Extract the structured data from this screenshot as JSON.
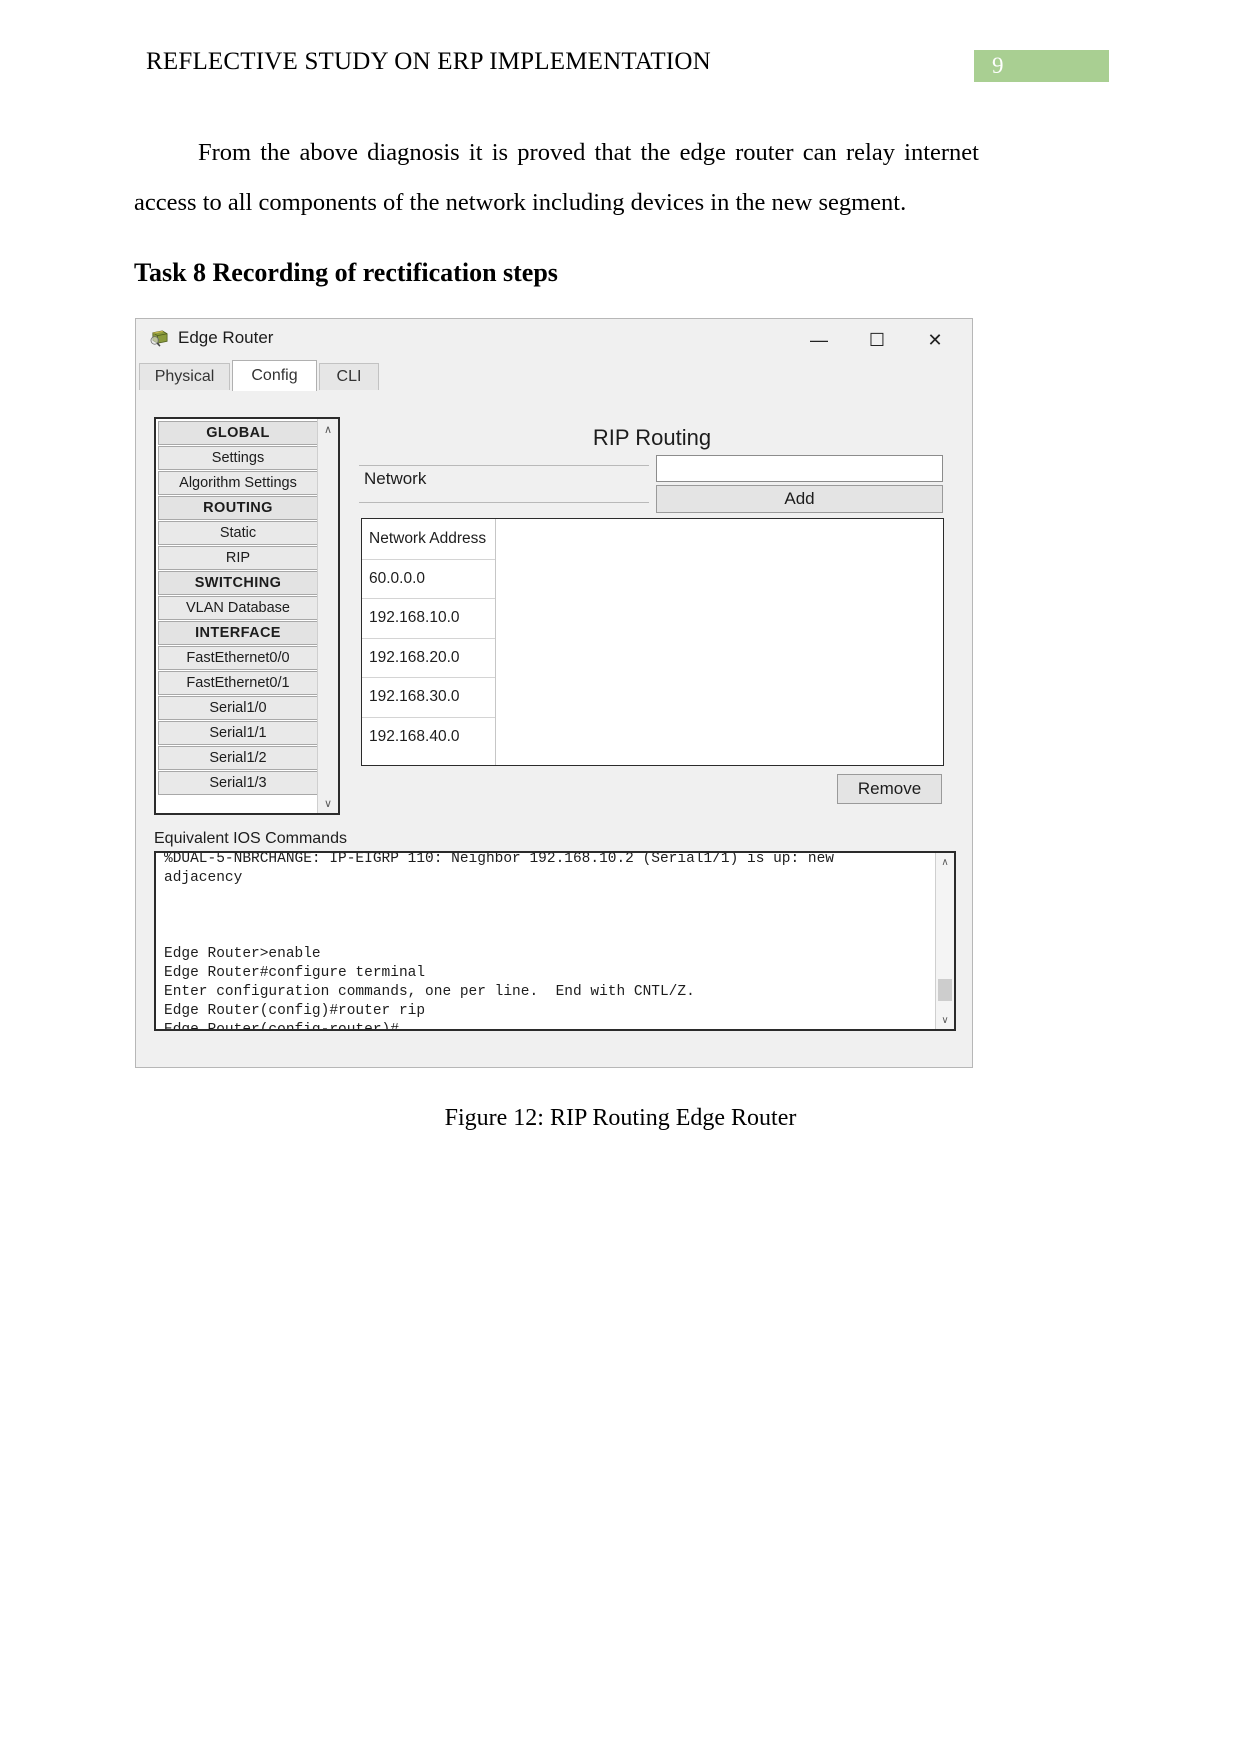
{
  "document": {
    "header_title": "REFLECTIVE STUDY ON ERP IMPLEMENTATION",
    "page_number": "9",
    "page_badge_color": "#a9cf92",
    "paragraph_1": "From the above diagnosis it is proved that the edge router can relay internet access to all components of the network including devices in the new segment.",
    "task_heading": "Task 8 Recording of rectification steps",
    "figure_caption": "Figure 12: RIP Routing Edge Router"
  },
  "window": {
    "title": "Edge Router",
    "icon": "router-device-icon",
    "controls": {
      "minimize": "—",
      "maximize": "☐",
      "close": "✕"
    },
    "tabs": [
      {
        "label": "Physical",
        "active": false
      },
      {
        "label": "Config",
        "active": true
      },
      {
        "label": "CLI",
        "active": false
      }
    ],
    "sidebar": {
      "scroll_up": "∧",
      "scroll_down": "∨",
      "items": [
        {
          "label": "GLOBAL",
          "type": "section"
        },
        {
          "label": "Settings",
          "type": "item"
        },
        {
          "label": "Algorithm Settings",
          "type": "item"
        },
        {
          "label": "ROUTING",
          "type": "section"
        },
        {
          "label": "Static",
          "type": "item"
        },
        {
          "label": "RIP",
          "type": "item"
        },
        {
          "label": "SWITCHING",
          "type": "section"
        },
        {
          "label": "VLAN Database",
          "type": "item"
        },
        {
          "label": "INTERFACE",
          "type": "section"
        },
        {
          "label": "FastEthernet0/0",
          "type": "item"
        },
        {
          "label": "FastEthernet0/1",
          "type": "item"
        },
        {
          "label": "Serial1/0",
          "type": "item"
        },
        {
          "label": "Serial1/1",
          "type": "item"
        },
        {
          "label": "Serial1/2",
          "type": "item"
        },
        {
          "label": "Serial1/3",
          "type": "item"
        }
      ]
    },
    "rip_panel": {
      "title": "RIP Routing",
      "network_label": "Network",
      "network_value": "",
      "network_placeholder": "",
      "add_label": "Add",
      "remove_label": "Remove",
      "table": {
        "header": "Network Address",
        "rows": [
          "60.0.0.0",
          "192.168.10.0",
          "192.168.20.0",
          "192.168.30.0",
          "192.168.40.0"
        ]
      }
    },
    "ios": {
      "label": "Equivalent IOS Commands",
      "text": "%DUAL-5-NBRCHANGE: IP-EIGRP 110: Neighbor 192.168.10.2 (Serial1/1) is up: new\nadjacency\n\n\n\nEdge Router>enable\nEdge Router#configure terminal\nEnter configuration commands, one per line.  End with CNTL/Z.\nEdge Router(config)#router rip\nEdge Router(config-router)#",
      "scroll_up": "∧",
      "scroll_down": "∨"
    }
  }
}
